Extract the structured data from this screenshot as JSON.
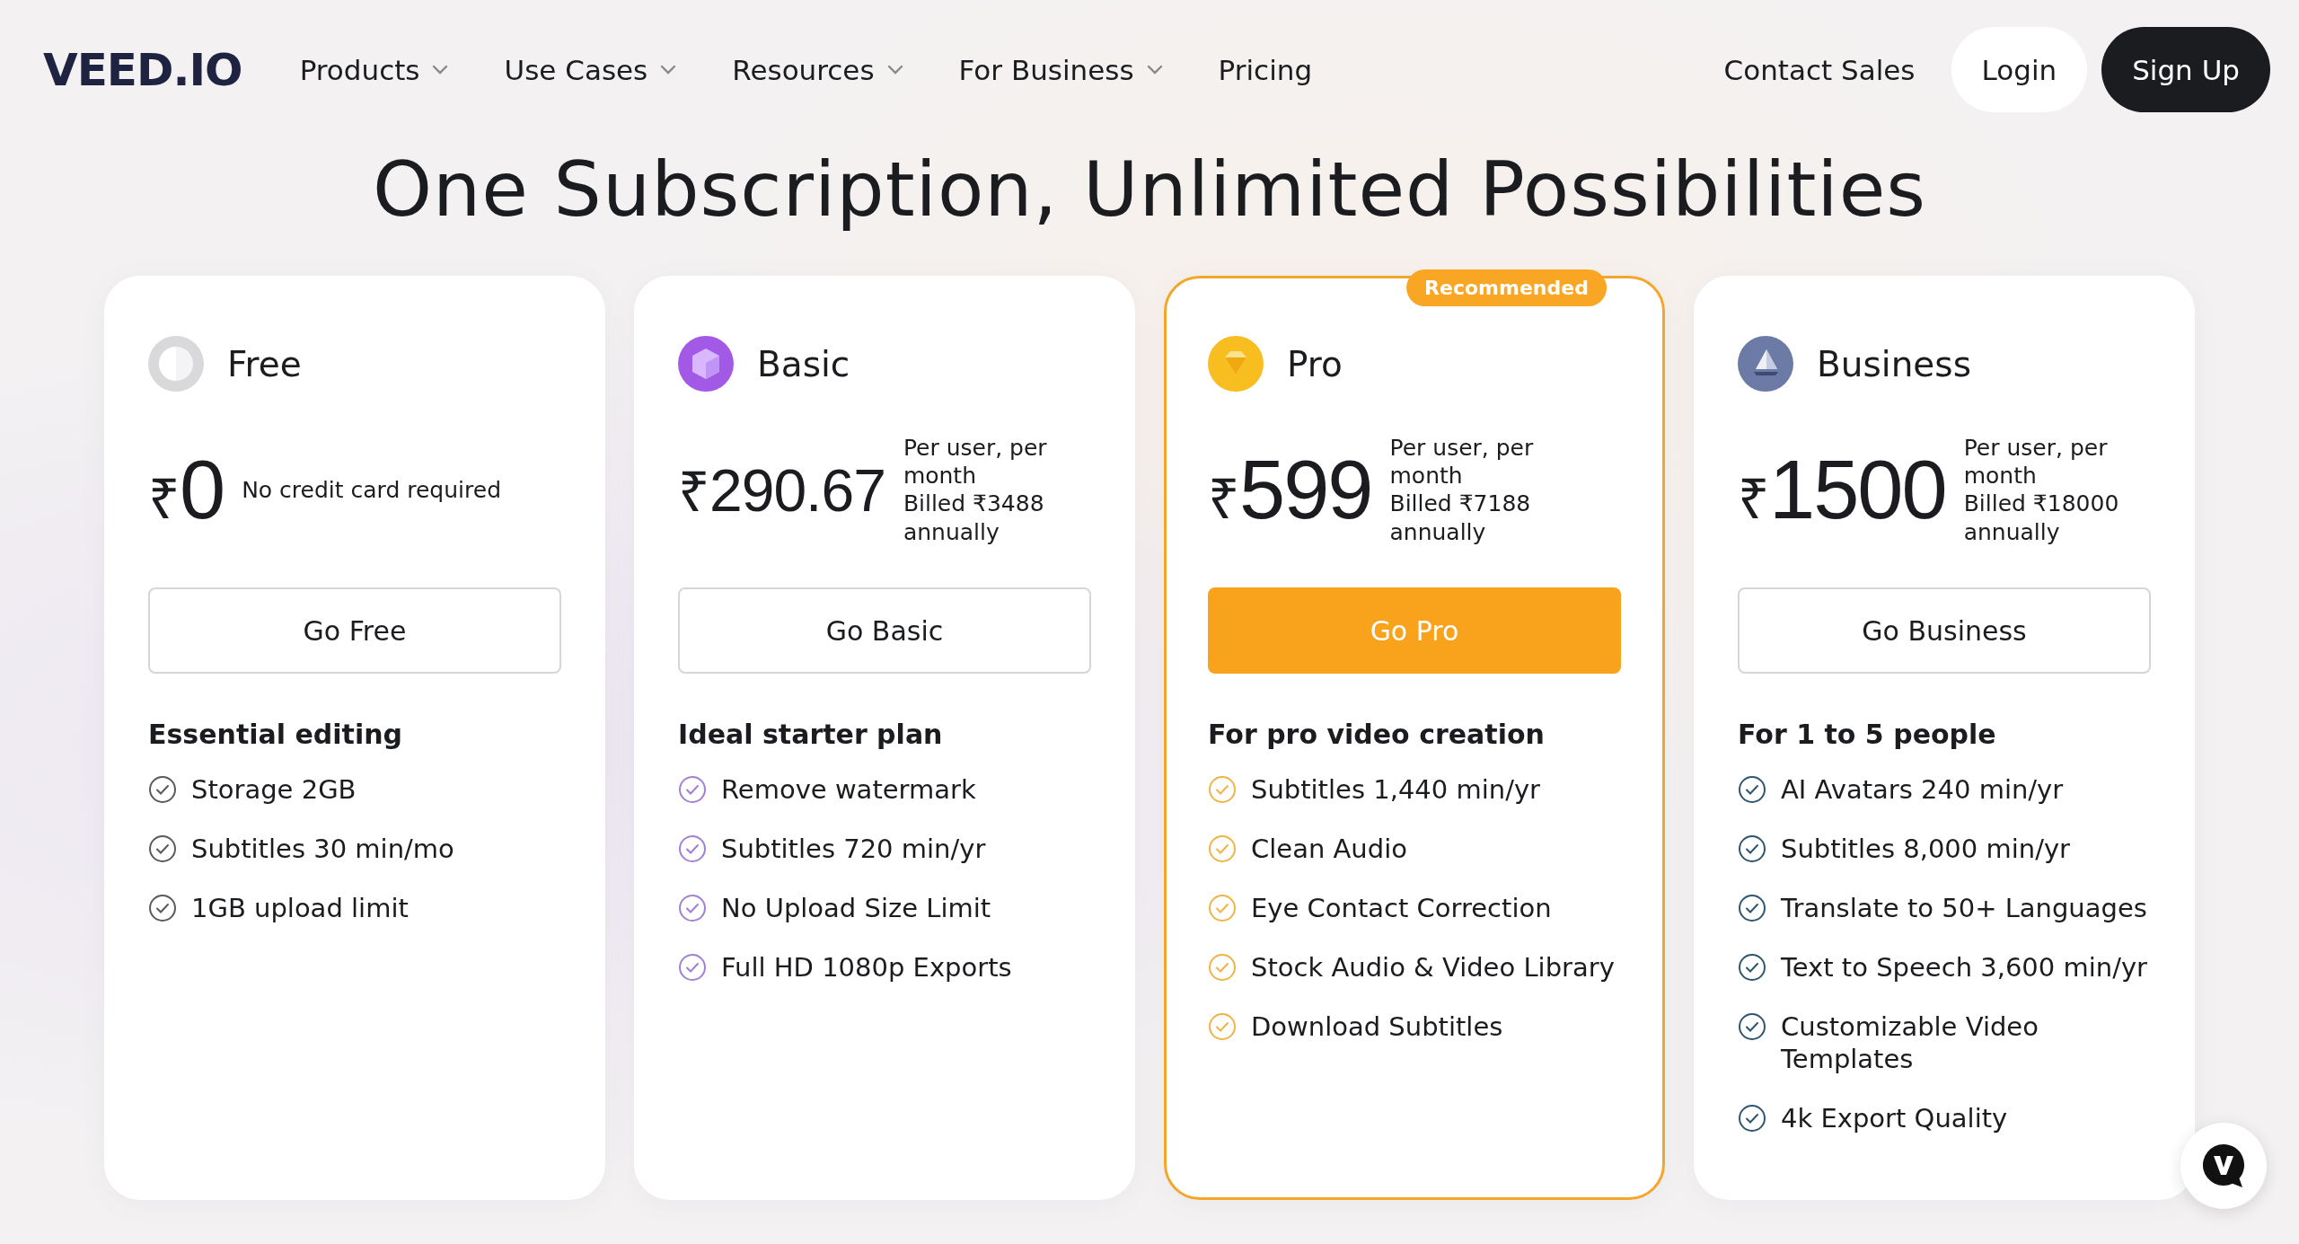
{
  "header": {
    "logo": "VEED.IO",
    "nav": [
      {
        "label": "Products",
        "dropdown": true
      },
      {
        "label": "Use Cases",
        "dropdown": true
      },
      {
        "label": "Resources",
        "dropdown": true
      },
      {
        "label": "For Business",
        "dropdown": true
      },
      {
        "label": "Pricing",
        "dropdown": false
      }
    ],
    "contact": "Contact Sales",
    "login": "Login",
    "signup": "Sign Up"
  },
  "title": "One Subscription, Unlimited Possibilities",
  "plans": [
    {
      "name": "Free",
      "color": "#5a5a5a",
      "featured": false,
      "currency": "₹",
      "amount": "0",
      "billing": [
        "No credit card required"
      ],
      "button": "Go Free",
      "heading": "Essential editing",
      "features": [
        "Storage 2GB",
        "Subtitles 30 min/mo",
        "1GB upload limit"
      ]
    },
    {
      "name": "Basic",
      "color": "#a27fd6",
      "featured": false,
      "currency": "₹",
      "amount": "290.67",
      "billing": [
        "Per user, per month",
        "Billed ₹3488 annually"
      ],
      "button": "Go Basic",
      "heading": "Ideal starter plan",
      "features": [
        "Remove watermark",
        "Subtitles 720 min/yr",
        "No Upload Size Limit",
        "Full HD 1080p Exports"
      ]
    },
    {
      "name": "Pro",
      "color": "#efb445",
      "featured": true,
      "badge": "Recommended",
      "currency": "₹",
      "amount": "599",
      "billing": [
        "Per user, per month",
        "Billed ₹7188 annually"
      ],
      "button": "Go Pro",
      "heading": "For pro video creation",
      "features": [
        "Subtitles 1,440 min/yr",
        "Clean Audio",
        "Eye Contact Correction",
        "Stock Audio & Video Library",
        "Download Subtitles"
      ]
    },
    {
      "name": "Business",
      "color": "#2f5670",
      "featured": false,
      "currency": "₹",
      "amount": "1500",
      "billing": [
        "Per user, per month",
        "Billed ₹18000 annually"
      ],
      "button": "Go Business",
      "heading": "For 1 to 5 people",
      "features": [
        "AI Avatars 240 min/yr",
        "Subtitles 8,000 min/yr",
        "Translate to 50+ Languages",
        "Text to Speech 3,600 min/yr",
        "Customizable Video Templates",
        "4k Export Quality"
      ]
    }
  ]
}
